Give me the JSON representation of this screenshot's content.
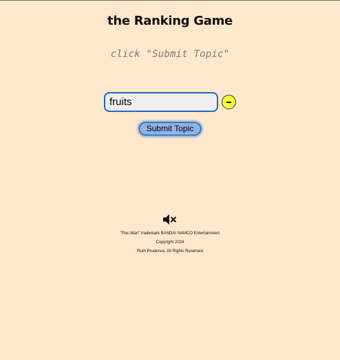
{
  "app": {
    "title": "the Ranking Game",
    "instruction": "click \"Submit Topic\""
  },
  "topic": {
    "value": "fruits",
    "remove_icon": "minus-circle-icon"
  },
  "submit": {
    "label": "Submit Topic"
  },
  "sound": {
    "icon": "speaker-muted-icon"
  },
  "footer": {
    "trademark": "\"Pac-Man\" trademark BANDAI NAMCO Entertainment",
    "copyright": "Copyright 2024",
    "rights": "Ruth Prudence, All Rights Reserved"
  },
  "colors": {
    "background": "#ffe8cc",
    "input_border": "#1f66c9",
    "remove_button": "#ffff33",
    "submit_button": "#8fb3e6"
  }
}
